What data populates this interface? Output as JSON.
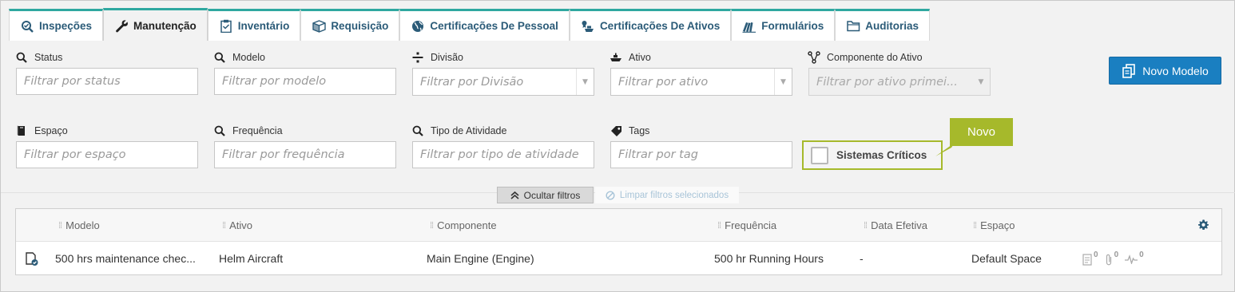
{
  "tabs": [
    {
      "label": "Inspeções",
      "icon": "magnify-check-icon",
      "active": false
    },
    {
      "label": "Manutenção",
      "icon": "wrench-icon",
      "active": true
    },
    {
      "label": "Inventário",
      "icon": "clipboard-icon",
      "active": false
    },
    {
      "label": "Requisição",
      "icon": "box-icon",
      "active": false
    },
    {
      "label": "Certificações De Pessoal",
      "icon": "globe-icon",
      "active": false
    },
    {
      "label": "Certificações De Ativos",
      "icon": "ship-cert-icon",
      "active": false
    },
    {
      "label": "Formulários",
      "icon": "books-icon",
      "active": false
    },
    {
      "label": "Auditorias",
      "icon": "folder-icon",
      "active": false
    }
  ],
  "filters": {
    "status": {
      "label": "Status",
      "placeholder": "Filtrar por status"
    },
    "modelo": {
      "label": "Modelo",
      "placeholder": "Filtrar por modelo"
    },
    "divisao": {
      "label": "Divisão",
      "placeholder": "Filtrar por Divisão"
    },
    "ativo": {
      "label": "Ativo",
      "placeholder": "Filtrar por ativo"
    },
    "componente": {
      "label": "Componente do Ativo",
      "placeholder": "Filtrar por ativo primei..."
    },
    "espaco": {
      "label": "Espaço",
      "placeholder": "Filtrar por espaço"
    },
    "frequencia": {
      "label": "Frequência",
      "placeholder": "Filtrar por frequência"
    },
    "tipo": {
      "label": "Tipo de Atividade",
      "placeholder": "Filtrar por tipo de atividade"
    },
    "tags": {
      "label": "Tags",
      "placeholder": "Filtrar por tag"
    }
  },
  "new_model_button": "Novo Modelo",
  "critical_systems": {
    "label": "Sistemas Críticos",
    "checked": false
  },
  "callout": "Novo",
  "hide_filters": "Ocultar filtros",
  "clear_filters": "Limpar filtros selecionados",
  "table": {
    "columns": [
      "Modelo",
      "Ativo",
      "Componente",
      "Frequência",
      "Data Efetiva",
      "Espaço"
    ],
    "rows": [
      {
        "modelo": "500 hrs maintenance chec...",
        "ativo": "Helm Aircraft",
        "componente": "Main Engine (Engine)",
        "frequencia": "500 hr Running Hours",
        "data_efetiva": "-",
        "espaco": "Default Space",
        "notes_count": "0",
        "attachments_count": "0",
        "activity_count": "0"
      }
    ]
  },
  "colors": {
    "accent_teal": "#2fa8a0",
    "primary_blue": "#1a7fc1",
    "highlight_green": "#a6b92b",
    "tab_text": "#2b5b78"
  }
}
